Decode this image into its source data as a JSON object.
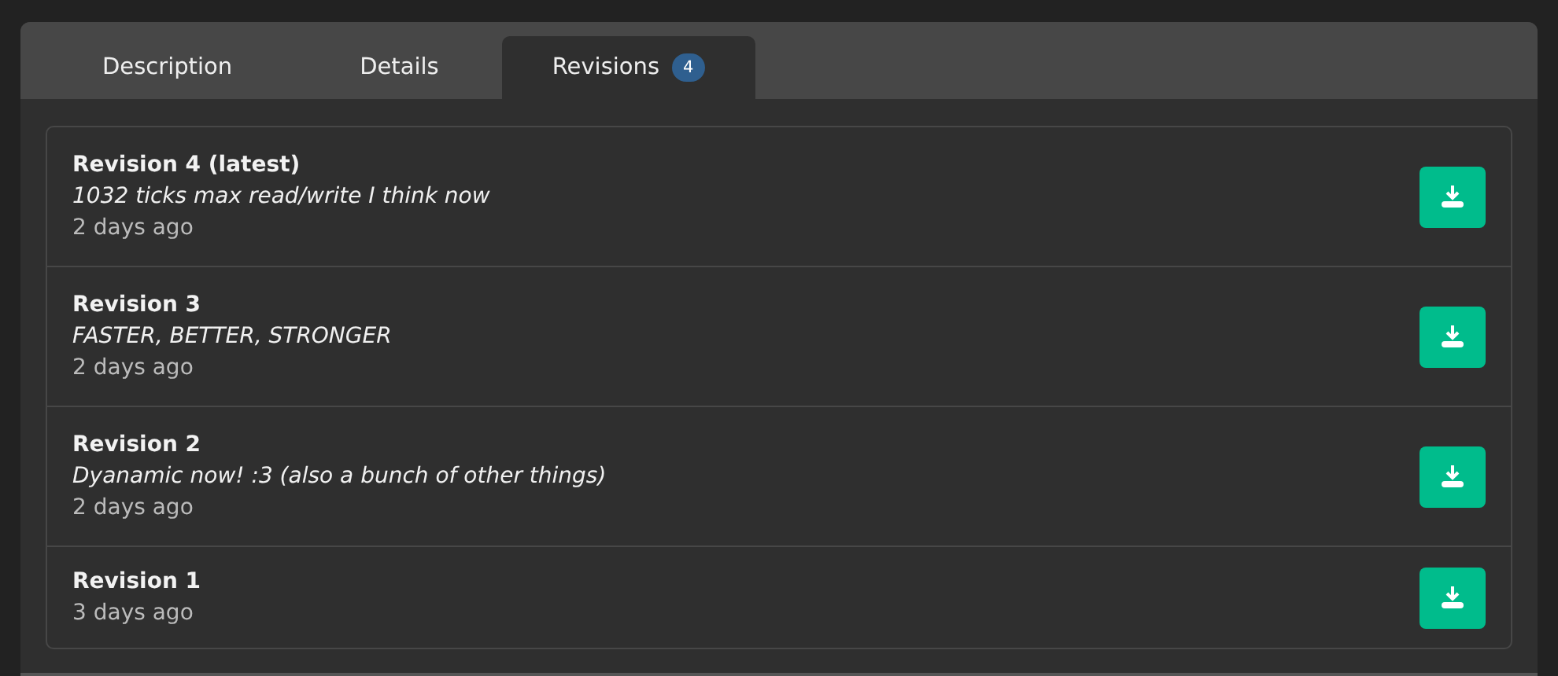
{
  "tabs": [
    {
      "label": "Description",
      "selected": false
    },
    {
      "label": "Details",
      "selected": false
    },
    {
      "label": "Revisions",
      "selected": true,
      "badge": "4"
    }
  ],
  "revisions": [
    {
      "title": "Revision 4 (latest)",
      "message": "1032 ticks max read/write I think now",
      "time": "2 days ago"
    },
    {
      "title": "Revision 3",
      "message": "FASTER, BETTER, STRONGER",
      "time": "2 days ago"
    },
    {
      "title": "Revision 2",
      "message": "Dyanamic now! :3 (also a bunch of other things)",
      "time": "2 days ago"
    },
    {
      "title": "Revision 1",
      "time": "3 days ago"
    }
  ]
}
